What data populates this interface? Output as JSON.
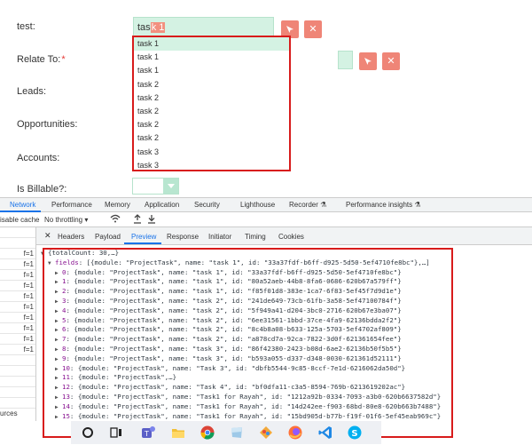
{
  "form": {
    "labels": {
      "test": "test:",
      "relate_to": "Relate To:",
      "required_mark": "*",
      "leads": "Leads:",
      "opportunities": "Opportunities:",
      "accounts": "Accounts:",
      "is_billable": "Is Billable?:"
    },
    "test_input": {
      "prefix": "tas",
      "selected": "k 1"
    },
    "dropdown_items": [
      "task 1",
      "task 1",
      "task 1",
      "task 2",
      "task 2",
      "task 2",
      "task 2",
      "task 2",
      "task 3",
      "task 3"
    ],
    "billable_value": ""
  },
  "devtools": {
    "tabs": [
      "Network",
      "Performance",
      "Memory",
      "Application",
      "Security",
      "Lighthouse",
      "Recorder",
      "Performance insights"
    ],
    "active_tab": "Network",
    "toolbar": {
      "disable_cache": "isable cache",
      "throttling": "No throttling"
    },
    "subtabs": [
      "Headers",
      "Payload",
      "Preview",
      "Response",
      "Initiator",
      "Timing",
      "Cookies"
    ],
    "active_subtab": "Preview",
    "left_rows": [
      "",
      "",
      "f=1",
      "f=1",
      "f=1",
      "f=1",
      "f=1",
      "f=1",
      "f=1",
      "f=1",
      "f=1",
      "f=1",
      "",
      "",
      "",
      "",
      "",
      "urces"
    ],
    "preview": {
      "root": "{totalCount: 30,…}",
      "fields_key": "fields",
      "fields_summary": "[{module: \"ProjectTask\", name: \"task 1\", id: \"33a37fdf-b6ff-d925-5d50-5ef4710fe8bc\"},…]",
      "items": [
        {
          "idx": "0",
          "text": "{module: \"ProjectTask\", name: \"task 1\", id: \"33a37fdf-b6ff-d925-5d50-5ef4710fe8bc\"}"
        },
        {
          "idx": "1",
          "text": "{module: \"ProjectTask\", name: \"task 1\", id: \"80a52aeb-44b8-8fa6-0686-620b67a579ff\"}"
        },
        {
          "idx": "2",
          "text": "{module: \"ProjectTask\", name: \"task 1\", id: \"f85f01d8-383e-1ca7-6f83-5ef45f7d9d1e\"}"
        },
        {
          "idx": "3",
          "text": "{module: \"ProjectTask\", name: \"task 2\", id: \"241de649-73cb-61fb-3a58-5ef47100784f\"}"
        },
        {
          "idx": "4",
          "text": "{module: \"ProjectTask\", name: \"task 2\", id: \"5f949a41-d204-3bc0-2716-620b67e3ba07\"}"
        },
        {
          "idx": "5",
          "text": "{module: \"ProjectTask\", name: \"task 2\", id: \"6ee31561-1bbd-37ce-4fa9-62136bdda2f2\"}"
        },
        {
          "idx": "6",
          "text": "{module: \"ProjectTask\", name: \"task 2\", id: \"8c4b8a08-b633-125a-5703-5ef4702af809\"}"
        },
        {
          "idx": "7",
          "text": "{module: \"ProjectTask\", name: \"task 2\", id: \"a878cd7a-92ca-7822-3d0f-621361654fee\"}"
        },
        {
          "idx": "8",
          "text": "{module: \"ProjectTask\", name: \"task 3\", id: \"86f42380-2423-b08d-6ae2-62136b50f5b5\"}"
        },
        {
          "idx": "9",
          "text": "{module: \"ProjectTask\", name: \"task 3\", id: \"b593a055-d337-d348-0030-621361d52111\"}"
        },
        {
          "idx": "10",
          "text": "{module: \"ProjectTask\", name: \"Task 3\", id: \"dbfb5544-9c85-8ccf-7e1d-6216062da50d\"}"
        },
        {
          "idx": "11",
          "text": "{module: \"ProjectTask\",…}"
        },
        {
          "idx": "12",
          "text": "{module: \"ProjectTask\", name: \"Task 4\", id: \"bf0dfa11-c3a5-8594-769b-6213619202ac\"}"
        },
        {
          "idx": "13",
          "text": "{module: \"ProjectTask\", name: \"Task1 for Rayah\", id: \"1212a92b-0334-7093-a3b0-620b6637582d\"}"
        },
        {
          "idx": "14",
          "text": "{module: \"ProjectTask\", name: \"Task1 for Rayah\", id: \"14d242ee-f903-68bd-80e8-620b663b7488\"}"
        },
        {
          "idx": "15",
          "text": "{module: \"ProjectTask\", name: \"Task1 for Rayah\", id: \"15bd905d-b77b-f19f-01f6-5ef45eab969c\"}"
        }
      ]
    }
  },
  "taskbar": {
    "icons": [
      "search-icon",
      "task-view-icon",
      "teams-icon",
      "file-explorer-icon",
      "chrome-icon",
      "app-icon",
      "paint-icon",
      "firefox-icon",
      "vscode-icon",
      "skype-icon"
    ]
  },
  "colors": {
    "accent": "#1a73e8",
    "mint": "#d4f2e3",
    "salmon": "#ef8577",
    "highlight_red": "#d81b1b"
  }
}
